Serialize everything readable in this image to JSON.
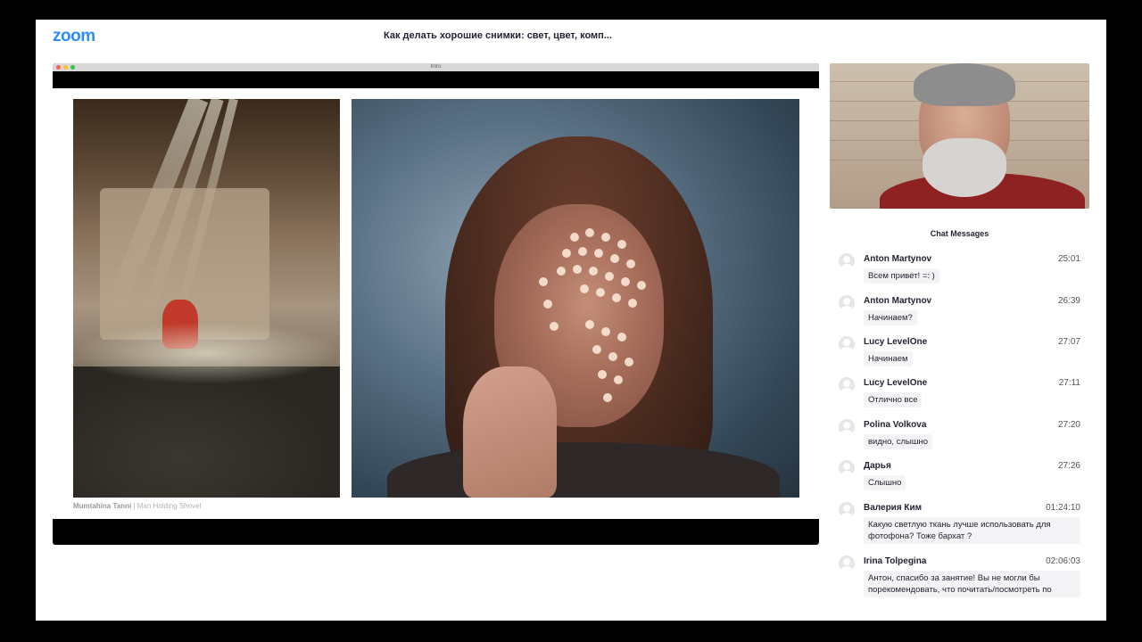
{
  "app": {
    "logo": "zoom",
    "meeting_title": "Как делать хорошие снимки: свет, цвет, комп...",
    "brand_color": "#2d8cff"
  },
  "share": {
    "window_title": "Intro",
    "caption_author": "Mumtahina Tanni",
    "caption_title": " | Man Holding Shovel"
  },
  "chat": {
    "title": "Chat Messages",
    "messages": [
      {
        "sender": "Anton Martynov",
        "time": "25:01",
        "text": "Всем привет! =: )"
      },
      {
        "sender": "Anton Martynov",
        "time": "26:39",
        "text": "Начинаем?"
      },
      {
        "sender": "Lucy LevelOne",
        "time": "27:07",
        "text": "Начинаем"
      },
      {
        "sender": "Lucy LevelOne",
        "time": "27:11",
        "text": "Отлично все"
      },
      {
        "sender": "Polina Volkova",
        "time": "27:20",
        "text": "видно, слышно"
      },
      {
        "sender": "Дарья",
        "time": "27:26",
        "text": "Слышно"
      },
      {
        "sender": "Валерия Ким",
        "time": "01:24:10",
        "text": "Какую светлую ткань лучше использовать для фотофона? Тоже бархат ?"
      },
      {
        "sender": "Irina Tolpegina",
        "time": "02:06:03",
        "text": "Антон, спасибо за занятие! Вы не могли бы порекомендовать, что почитать/посмотреть по"
      }
    ]
  }
}
